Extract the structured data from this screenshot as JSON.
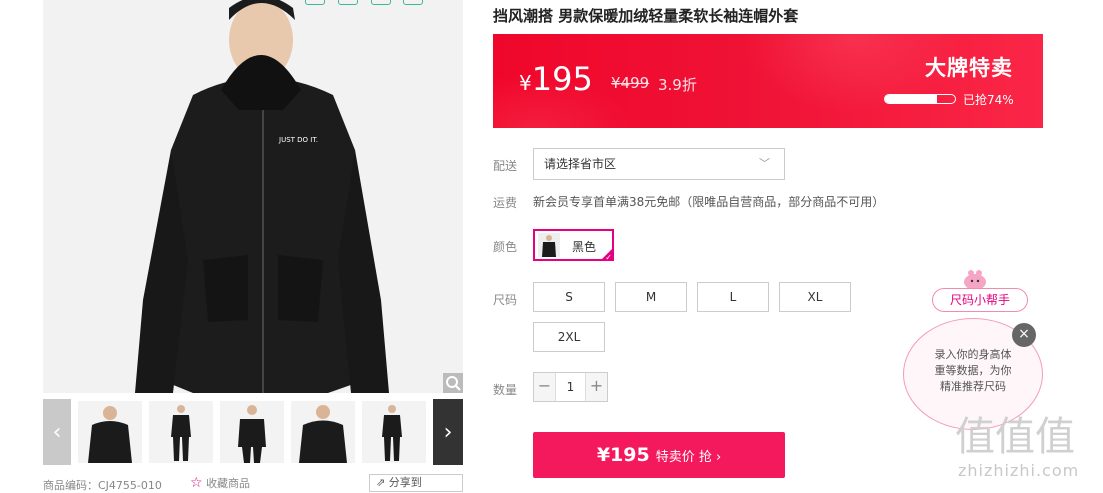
{
  "product": {
    "title": "挡风潮搭 男款保暖加绒轻量柔软长袖连帽外套",
    "code_label": "商品编码：CJ4755-010",
    "favorite_label": "收藏商品",
    "share_label": "分享到"
  },
  "banner": {
    "price_symbol": "¥",
    "price": "195",
    "original_price": "¥499",
    "discount": "3.9折",
    "brand_sale": "大牌特卖",
    "sold_text": "已抢74%",
    "sold_fraction": 0.74
  },
  "delivery": {
    "label": "配送",
    "placeholder": "请选择省市区"
  },
  "shipping": {
    "label": "运费",
    "text": "新会员专享首单满38元免邮（限唯品自营商品，部分商品不可用）"
  },
  "color": {
    "label": "颜色",
    "selected": "黑色"
  },
  "sizes": {
    "label": "尺码",
    "options": [
      "S",
      "M",
      "L",
      "XL",
      "2XL"
    ]
  },
  "quantity": {
    "label": "数量",
    "value": "1",
    "minus": "−",
    "plus": "+"
  },
  "buy": {
    "price": "¥195",
    "label": "特卖价 抢 ›"
  },
  "size_helper": {
    "tag": "尺码小帮手",
    "line1": "录入你的身高体",
    "line2": "重等数据，为你",
    "line3": "精准推荐尺码",
    "close": "×"
  },
  "thumbs": {
    "prev": "‹",
    "next": "›",
    "count": 5
  },
  "watermark": {
    "main": "值值值",
    "sub": "zhizhizhi.com"
  },
  "logo_text": "JUST DO IT."
}
